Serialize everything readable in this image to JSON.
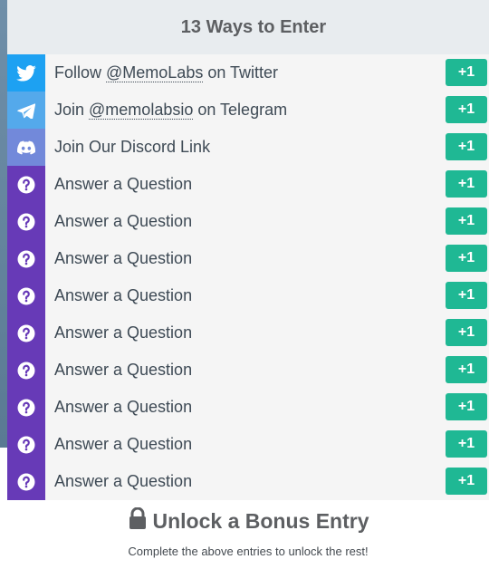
{
  "header": {
    "title": "13 Ways to Enter"
  },
  "colors": {
    "twitter": "#1da1f2",
    "telegram": "#54a9eb",
    "discord": "#7289da",
    "question": "#673ab7",
    "plus_button": "#1fb894"
  },
  "entries": [
    {
      "prefix": "Follow ",
      "handle": "@MemoLabs",
      "suffix": " on Twitter",
      "icon": "twitter-icon",
      "points": "+1"
    },
    {
      "prefix": "Join ",
      "handle": "@memolabsio",
      "suffix": " on Telegram",
      "icon": "telegram-icon",
      "points": "+1"
    },
    {
      "prefix": "Join Our Discord Link",
      "handle": "",
      "suffix": "",
      "icon": "discord-icon",
      "points": "+1"
    },
    {
      "prefix": "Answer a Question",
      "handle": "",
      "suffix": "",
      "icon": "question-icon",
      "points": "+1"
    },
    {
      "prefix": "Answer a Question",
      "handle": "",
      "suffix": "",
      "icon": "question-icon",
      "points": "+1"
    },
    {
      "prefix": "Answer a Question",
      "handle": "",
      "suffix": "",
      "icon": "question-icon",
      "points": "+1"
    },
    {
      "prefix": "Answer a Question",
      "handle": "",
      "suffix": "",
      "icon": "question-icon",
      "points": "+1"
    },
    {
      "prefix": "Answer a Question",
      "handle": "",
      "suffix": "",
      "icon": "question-icon",
      "points": "+1"
    },
    {
      "prefix": "Answer a Question",
      "handle": "",
      "suffix": "",
      "icon": "question-icon",
      "points": "+1"
    },
    {
      "prefix": "Answer a Question",
      "handle": "",
      "suffix": "",
      "icon": "question-icon",
      "points": "+1"
    },
    {
      "prefix": "Answer a Question",
      "handle": "",
      "suffix": "",
      "icon": "question-icon",
      "points": "+1"
    },
    {
      "prefix": "Answer a Question",
      "handle": "",
      "suffix": "",
      "icon": "question-icon",
      "points": "+1"
    }
  ],
  "footer": {
    "title": "Unlock a Bonus Entry",
    "subtitle": "Complete the above entries to unlock the rest!",
    "icon": "lock-icon"
  }
}
